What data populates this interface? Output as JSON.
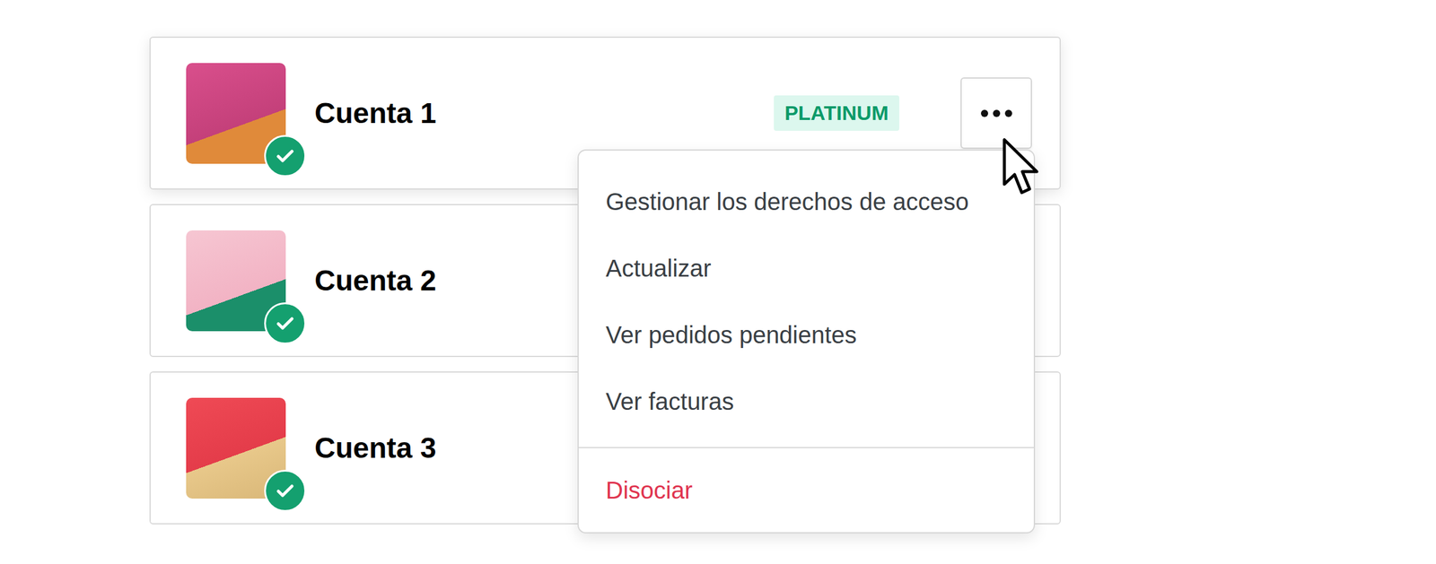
{
  "accounts": [
    {
      "name": "Cuenta 1",
      "badge": "PLATINUM",
      "verified": true,
      "menu_open": true
    },
    {
      "name": "Cuenta 2",
      "verified": true,
      "menu_open": false
    },
    {
      "name": "Cuenta 3",
      "verified": true,
      "menu_open": false
    }
  ],
  "menu": {
    "items": [
      {
        "label": "Gestionar los derechos de acceso",
        "kind": "normal"
      },
      {
        "label": "Actualizar",
        "kind": "normal"
      },
      {
        "label": "Ver pedidos pendientes",
        "kind": "normal"
      },
      {
        "label": "Ver facturas",
        "kind": "normal"
      },
      {
        "label": "Disociar",
        "kind": "danger"
      }
    ]
  }
}
